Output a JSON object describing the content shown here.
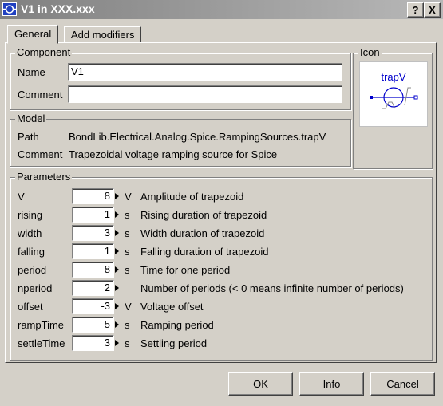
{
  "window": {
    "title": "V1 in XXX.xxx",
    "help_label": "?",
    "close_label": "X"
  },
  "tabs": [
    {
      "label": "General"
    },
    {
      "label": "Add modifiers"
    }
  ],
  "component": {
    "title": "Component",
    "name_label": "Name",
    "name_value": "V1",
    "comment_label": "Comment",
    "comment_value": ""
  },
  "icon_group": {
    "title": "Icon",
    "icon_label": "trapV"
  },
  "model": {
    "title": "Model",
    "path_label": "Path",
    "path_value": "BondLib.Electrical.Analog.Spice.RampingSources.trapV",
    "comment_label": "Comment",
    "comment_value": "Trapezoidal voltage ramping source for Spice"
  },
  "parameters": {
    "title": "Parameters",
    "rows": [
      {
        "name": "V",
        "value": "8",
        "unit": "V",
        "desc": "Amplitude of trapezoid"
      },
      {
        "name": "rising",
        "value": "1",
        "unit": "s",
        "desc": "Rising duration of trapezoid"
      },
      {
        "name": "width",
        "value": "3",
        "unit": "s",
        "desc": "Width duration of trapezoid"
      },
      {
        "name": "falling",
        "value": "1",
        "unit": "s",
        "desc": "Falling duration of trapezoid"
      },
      {
        "name": "period",
        "value": "8",
        "unit": "s",
        "desc": "Time for one period"
      },
      {
        "name": "nperiod",
        "value": "2",
        "unit": "",
        "desc": "Number of periods (< 0 means infinite number of periods)"
      },
      {
        "name": "offset",
        "value": "-3",
        "unit": "V",
        "desc": "Voltage offset"
      },
      {
        "name": "rampTime",
        "value": "5",
        "unit": "s",
        "desc": "Ramping period"
      },
      {
        "name": "settleTime",
        "value": "3",
        "unit": "s",
        "desc": "Settling period"
      }
    ]
  },
  "buttons": {
    "ok": "OK",
    "info": "Info",
    "cancel": "Cancel"
  },
  "colors": {
    "icon_blue": "#0000cc"
  }
}
